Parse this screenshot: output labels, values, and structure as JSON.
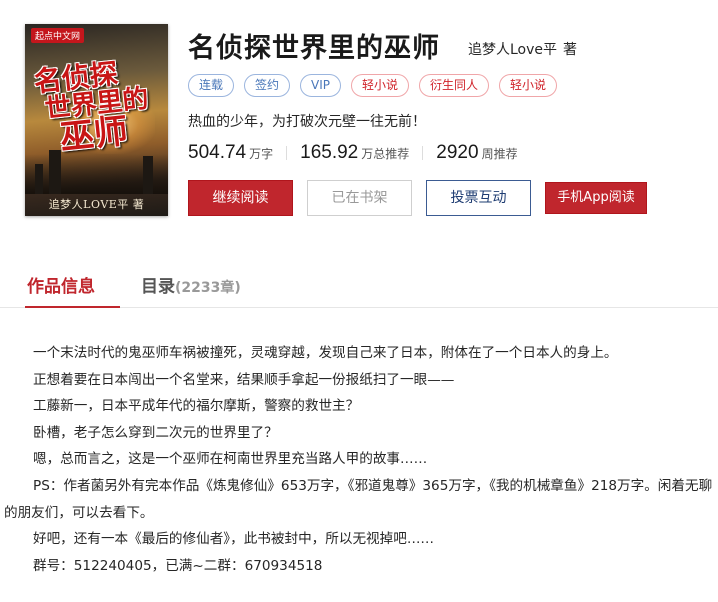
{
  "book": {
    "title": "名侦探世界里的巫师",
    "author": "追梦人Love平",
    "author_suffix": "著",
    "cover": {
      "brand": "起点中文网",
      "title_lines": [
        "名侦探",
        "世界里的",
        "巫师"
      ],
      "author": "追梦人LOVE平 著"
    },
    "tags": [
      {
        "label": "连载",
        "color": "blue"
      },
      {
        "label": "签约",
        "color": "blue"
      },
      {
        "label": "VIP",
        "color": "blue"
      },
      {
        "label": "轻小说",
        "color": "red"
      },
      {
        "label": "衍生同人",
        "color": "red"
      },
      {
        "label": "轻小说",
        "color": "red"
      }
    ],
    "intro": "热血的少年，为打破次元壁一往无前！",
    "stats": [
      {
        "num": "504.74",
        "unit": "万字"
      },
      {
        "num": "165.92",
        "unit": "万总推荐"
      },
      {
        "num": "2920",
        "unit": "周推荐"
      }
    ]
  },
  "actions": {
    "read": "继续阅读",
    "shelf": "已在书架",
    "vote": "投票互动",
    "app": "手机App阅读"
  },
  "tabs": {
    "info": "作品信息",
    "catalog": "目录",
    "catalog_count": "(2233章)"
  },
  "description": [
    "一个末法时代的鬼巫师车祸被撞死，灵魂穿越，发现自己来了日本，附体在了一个日本人的身上。",
    "正想着要在日本闯出一个名堂来，结果顺手拿起一份报纸扫了一眼——",
    "工藤新一，日本平成年代的福尔摩斯，警察的救世主？",
    "卧槽，老子怎么穿到二次元的世界里了？",
    "嗯，总而言之，这是一个巫师在柯南世界里充当路人甲的故事……",
    "PS：作者菌另外有完本作品《炼鬼修仙》653万字，《邪道鬼尊》365万字，《我的机械章鱼》218万字。闲着无聊的朋友们，可以去看下。",
    "好吧，还有一本《最后的修仙者》，此书被封中，所以无视掉吧……",
    "群号：512240405，已满~二群：670934518"
  ],
  "colors": {
    "accent": "#c0262d",
    "tag_blue": "#4a77b9",
    "tag_red": "#d0242b"
  }
}
